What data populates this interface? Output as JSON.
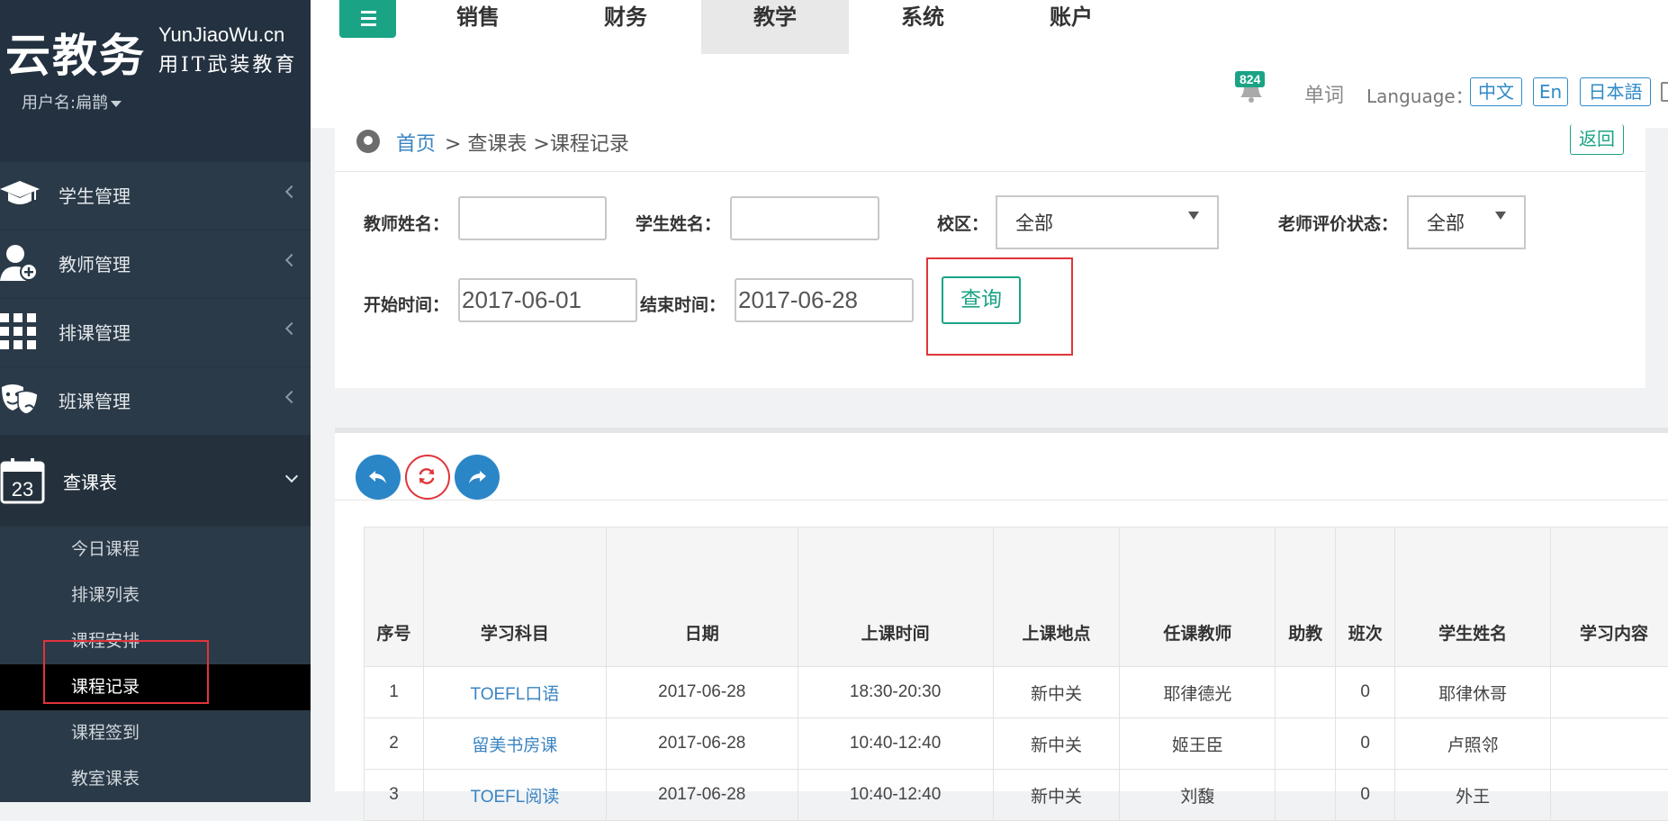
{
  "brand": {
    "logo_main": "云教务",
    "logo_en": "YunJiaoWu.cn",
    "logo_cn": "用IT武装教育",
    "user_label": "用户名:扁鹊"
  },
  "sidebar": {
    "menu": [
      {
        "label": "学生管理",
        "icon": "graduation-cap-icon"
      },
      {
        "label": "教师管理",
        "icon": "user-add-icon"
      },
      {
        "label": "排课管理",
        "icon": "grid-icon"
      },
      {
        "label": "班课管理",
        "icon": "theater-masks-icon"
      },
      {
        "label": "查课表",
        "icon": "calendar-icon",
        "calendar_day": "23"
      }
    ],
    "submenu": [
      "今日课程",
      "排课列表",
      "课程安排",
      "课程记录",
      "课程签到",
      "教室课表"
    ],
    "active_sub": "课程记录"
  },
  "topnav": {
    "tabs": [
      "销售",
      "财务",
      "教学",
      "系统",
      "账户"
    ],
    "active_tab": "教学"
  },
  "infobar": {
    "badge_count": "824",
    "word_label": "单词",
    "language_label": "Language：",
    "languages": [
      "中文",
      "En",
      "日本語"
    ]
  },
  "breadcrumb": {
    "home": "首页",
    "rest": " > 查课表 >课程记录",
    "back_label": "返回"
  },
  "filters": {
    "teacher_name_label": "教师姓名：",
    "teacher_name_value": "",
    "student_name_label": "学生姓名：",
    "student_name_value": "",
    "campus_label": "校区：",
    "campus_value": "全部",
    "eval_status_label": "老师评价状态：",
    "eval_status_value": "全部",
    "start_label": "开始时间：",
    "start_value": "2017-06-01",
    "end_label": "结束时间：",
    "end_value": "2017-06-28",
    "query_label": "查询"
  },
  "colors": {
    "accent": "#1aa385",
    "link": "#3a84c2",
    "sidebar_bg": "#2b3a48",
    "highlight": "#e0343a"
  },
  "table": {
    "headers": [
      "序号",
      "学习科目",
      "日期",
      "上课时间",
      "上课地点",
      "任课教师",
      "助教",
      "班次",
      "学生姓名",
      "学习内容"
    ],
    "rows": [
      [
        "1",
        "TOEFL口语",
        "2017-06-28",
        "18:30-20:30",
        "新中关",
        "耶律德光",
        "",
        "0",
        "耶律休哥",
        ""
      ],
      [
        "2",
        "留美书房课",
        "2017-06-28",
        "10:40-12:40",
        "新中关",
        "姬王臣",
        "",
        "0",
        "卢照邻",
        ""
      ],
      [
        "3",
        "TOEFL阅读",
        "2017-06-28",
        "10:40-12:40",
        "新中关",
        "刘馥",
        "",
        "0",
        "外王",
        ""
      ]
    ]
  }
}
